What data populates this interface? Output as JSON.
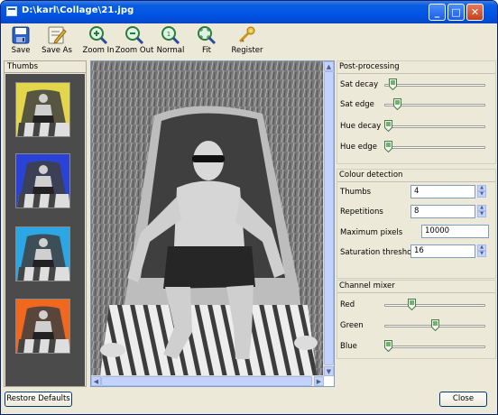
{
  "window": {
    "title": "D:\\karl\\Collage\\21.jpg",
    "controls": {
      "minimize_label": "_",
      "maximize_label": "□",
      "close_label": "✕"
    }
  },
  "toolbar": {
    "save_label": "Save",
    "save_as_label": "Save As",
    "zoom_in_label": "Zoom In",
    "zoom_out_label": "Zoom Out",
    "normal_label": "Normal",
    "fit_label": "Fit",
    "register_label": "Register"
  },
  "thumbs": {
    "header": "Thumbs",
    "items": [
      {
        "tint": "#e3d64a"
      },
      {
        "tint": "#2a43d6"
      },
      {
        "tint": "#2ba7e6"
      },
      {
        "tint": "#f0681e"
      }
    ]
  },
  "image": {
    "vscroll_fraction": 0.03,
    "hscroll_fraction": 0.0
  },
  "post_processing": {
    "title": "Post-processing",
    "sliders": [
      {
        "label": "Sat decay",
        "value": 0.05
      },
      {
        "label": "Sat edge",
        "value": 0.1
      },
      {
        "label": "Hue decay",
        "value": 0.0
      },
      {
        "label": "Hue edge",
        "value": 0.0
      }
    ]
  },
  "colour_detection": {
    "title": "Colour detection",
    "thumbs_label": "Thumbs",
    "thumbs_value": "4",
    "repetitions_label": "Repetitions",
    "repetitions_value": "8",
    "max_pixels_label": "Maximum pixels",
    "max_pixels_value": "10000",
    "sat_threshold_label": "Saturation threshold",
    "sat_threshold_value": "16"
  },
  "channel_mixer": {
    "title": "Channel mixer",
    "sliders": [
      {
        "label": "Red",
        "value": 0.25
      },
      {
        "label": "Green",
        "value": 0.5
      },
      {
        "label": "Blue",
        "value": 0.0
      }
    ]
  },
  "footer": {
    "restore_label": "Restore Defaults",
    "close_label": "Close"
  }
}
